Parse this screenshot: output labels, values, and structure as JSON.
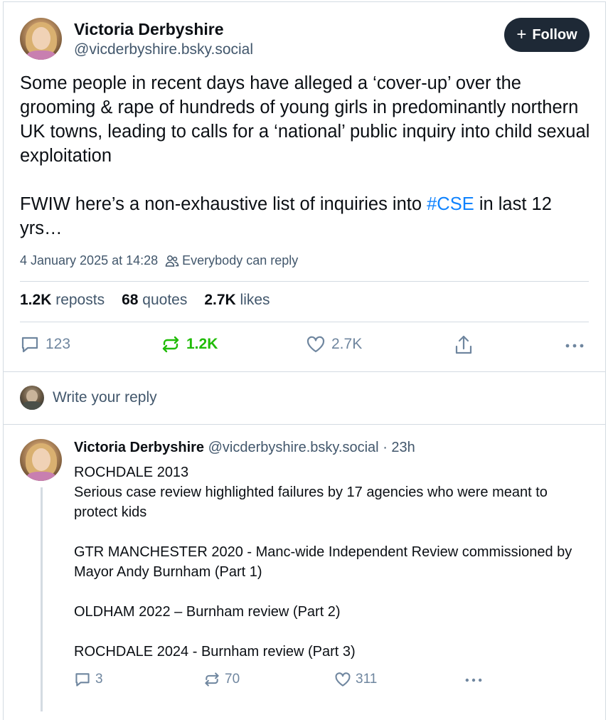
{
  "post": {
    "author": {
      "display_name": "Victoria Derbyshire",
      "handle": "@vicderbyshire.bsky.social",
      "avatar_icon": "avatar-photo"
    },
    "follow_button": {
      "label": "Follow",
      "icon": "plus-icon"
    },
    "text_part1": "Some people in recent days have alleged a ‘cover-up’ over the grooming & rape of hundreds of young girls in predominantly northern UK towns, leading to calls for a ‘national’ public inquiry into child sexual exploitation\n\nFWIW here’s a non-exhaustive list of inquiries into ",
    "hashtag": "#CSE",
    "text_part2": " in last 12 yrs…",
    "timestamp": "4 January 2025 at 14:28",
    "reply_setting": "Everybody can reply",
    "stats": {
      "reposts_count": "1.2K",
      "reposts_label": "reposts",
      "quotes_count": "68",
      "quotes_label": "quotes",
      "likes_count": "2.7K",
      "likes_label": "likes"
    },
    "actions": {
      "reply_count": "123",
      "repost_count": "1.2K",
      "like_count": "2.7K"
    },
    "colors": {
      "accent_link": "#1083fe",
      "repost_active": "#20bc07",
      "follow_bg": "#1e2936",
      "muted": "#42576c"
    }
  },
  "compose": {
    "placeholder": "Write your reply"
  },
  "reply": {
    "author": {
      "display_name": "Victoria Derbyshire",
      "handle": "@vicderbyshire.bsky.social",
      "separator": "·",
      "age": "23h"
    },
    "text": "ROCHDALE 2013\nSerious case review highlighted failures by 17 agencies who were meant to protect kids\n\nGTR MANCHESTER 2020 - Manc-wide Independent Review commissioned by Mayor Andy Burnham (Part 1)\n\nOLDHAM 2022 – Burnham review (Part 2)\n\nROCHDALE 2024 - Burnham review (Part 3)",
    "actions": {
      "reply_count": "3",
      "repost_count": "70",
      "like_count": "311"
    }
  }
}
